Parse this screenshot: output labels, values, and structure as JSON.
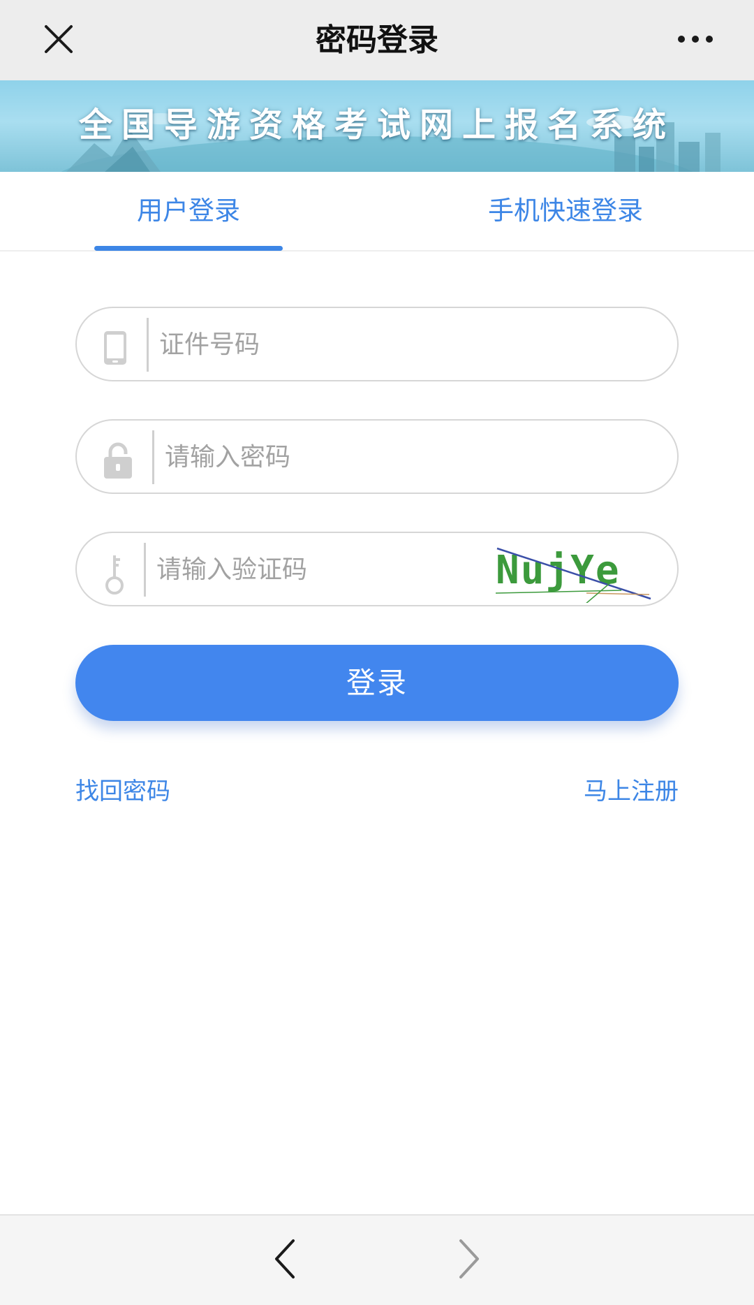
{
  "header": {
    "title": "密码登录",
    "close_icon": "close-icon",
    "more_icon": "more-dots-icon"
  },
  "banner": {
    "title": "全国导游资格考试网上报名系统"
  },
  "tabs": [
    {
      "label": "用户登录",
      "active": true
    },
    {
      "label": "手机快速登录",
      "active": false
    }
  ],
  "form": {
    "id_field": {
      "placeholder": "证件号码",
      "value": "",
      "icon": "phone-icon"
    },
    "password_field": {
      "placeholder": "请输入密码",
      "value": "",
      "icon": "lock-icon"
    },
    "captcha_field": {
      "placeholder": "请输入验证码",
      "value": "",
      "icon": "key-icon"
    },
    "captcha_text": "NujYe",
    "login_label": "登录"
  },
  "links": {
    "forgot": "找回密码",
    "register": "马上注册"
  },
  "bottom_nav": {
    "back_icon": "chevron-left-icon",
    "forward_icon": "chevron-right-icon"
  },
  "colors": {
    "accent": "#4286ee",
    "link": "#3d86e6",
    "captcha": "#3c9a3c"
  }
}
